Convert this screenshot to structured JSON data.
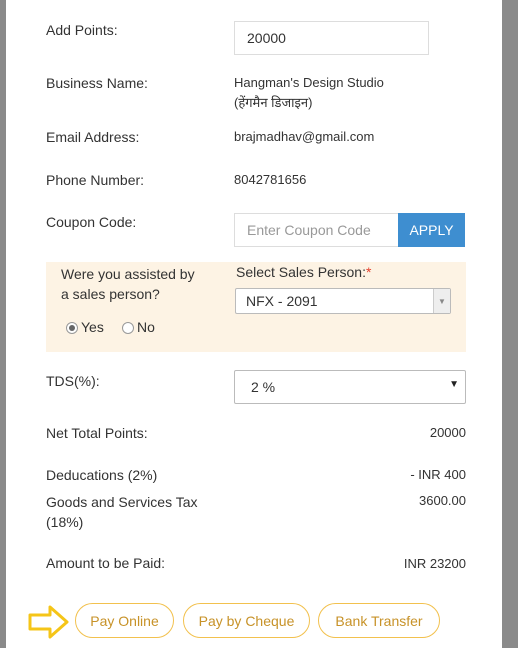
{
  "form": {
    "add_points_label": "Add Points:",
    "add_points_value": "20000",
    "business_name_label": "Business Name:",
    "business_name_line1": "Hangman's Design Studio",
    "business_name_line2": "(हेंगमैन डिजाइन)",
    "email_label": "Email Address:",
    "email_value": "brajmadhav@gmail.com",
    "phone_label": "Phone Number:",
    "phone_value": "8042781656",
    "coupon_label": "Coupon Code:",
    "coupon_placeholder": "Enter Coupon Code",
    "apply_label": "APPLY"
  },
  "sales": {
    "question_line1": "Were you assisted by",
    "question_line2": "a sales person?",
    "yes_label": "Yes",
    "no_label": "No",
    "selected": "Yes",
    "select_label": "Select Sales Person:",
    "required_mark": "*",
    "select_value": "NFX - 2091"
  },
  "summary": {
    "tds_label": "TDS(%):",
    "tds_value": "2 %",
    "net_total_label": "Net Total Points:",
    "net_total_value": "20000",
    "deductions_label": "Deducations (2%)",
    "deductions_value": "- INR 400",
    "gst_label_line1": "Goods and Services Tax",
    "gst_label_line2": "(18%)",
    "gst_value": "3600.00",
    "amount_label": "Amount to be Paid:",
    "amount_value": "INR 23200"
  },
  "payment": {
    "pay_online": "Pay Online",
    "pay_cheque": "Pay by Cheque",
    "bank_transfer": "Bank Transfer"
  },
  "colors": {
    "accent_blue": "#3e8ed0",
    "pill_border": "#f2c14e",
    "pill_text": "#c79228",
    "arrow": "#f5c518",
    "sales_box_bg": "#fdf3e4",
    "required": "#e4402c"
  },
  "icons": {
    "arrow": "right-arrow-icon",
    "dropdown": "chevron-down-icon"
  }
}
